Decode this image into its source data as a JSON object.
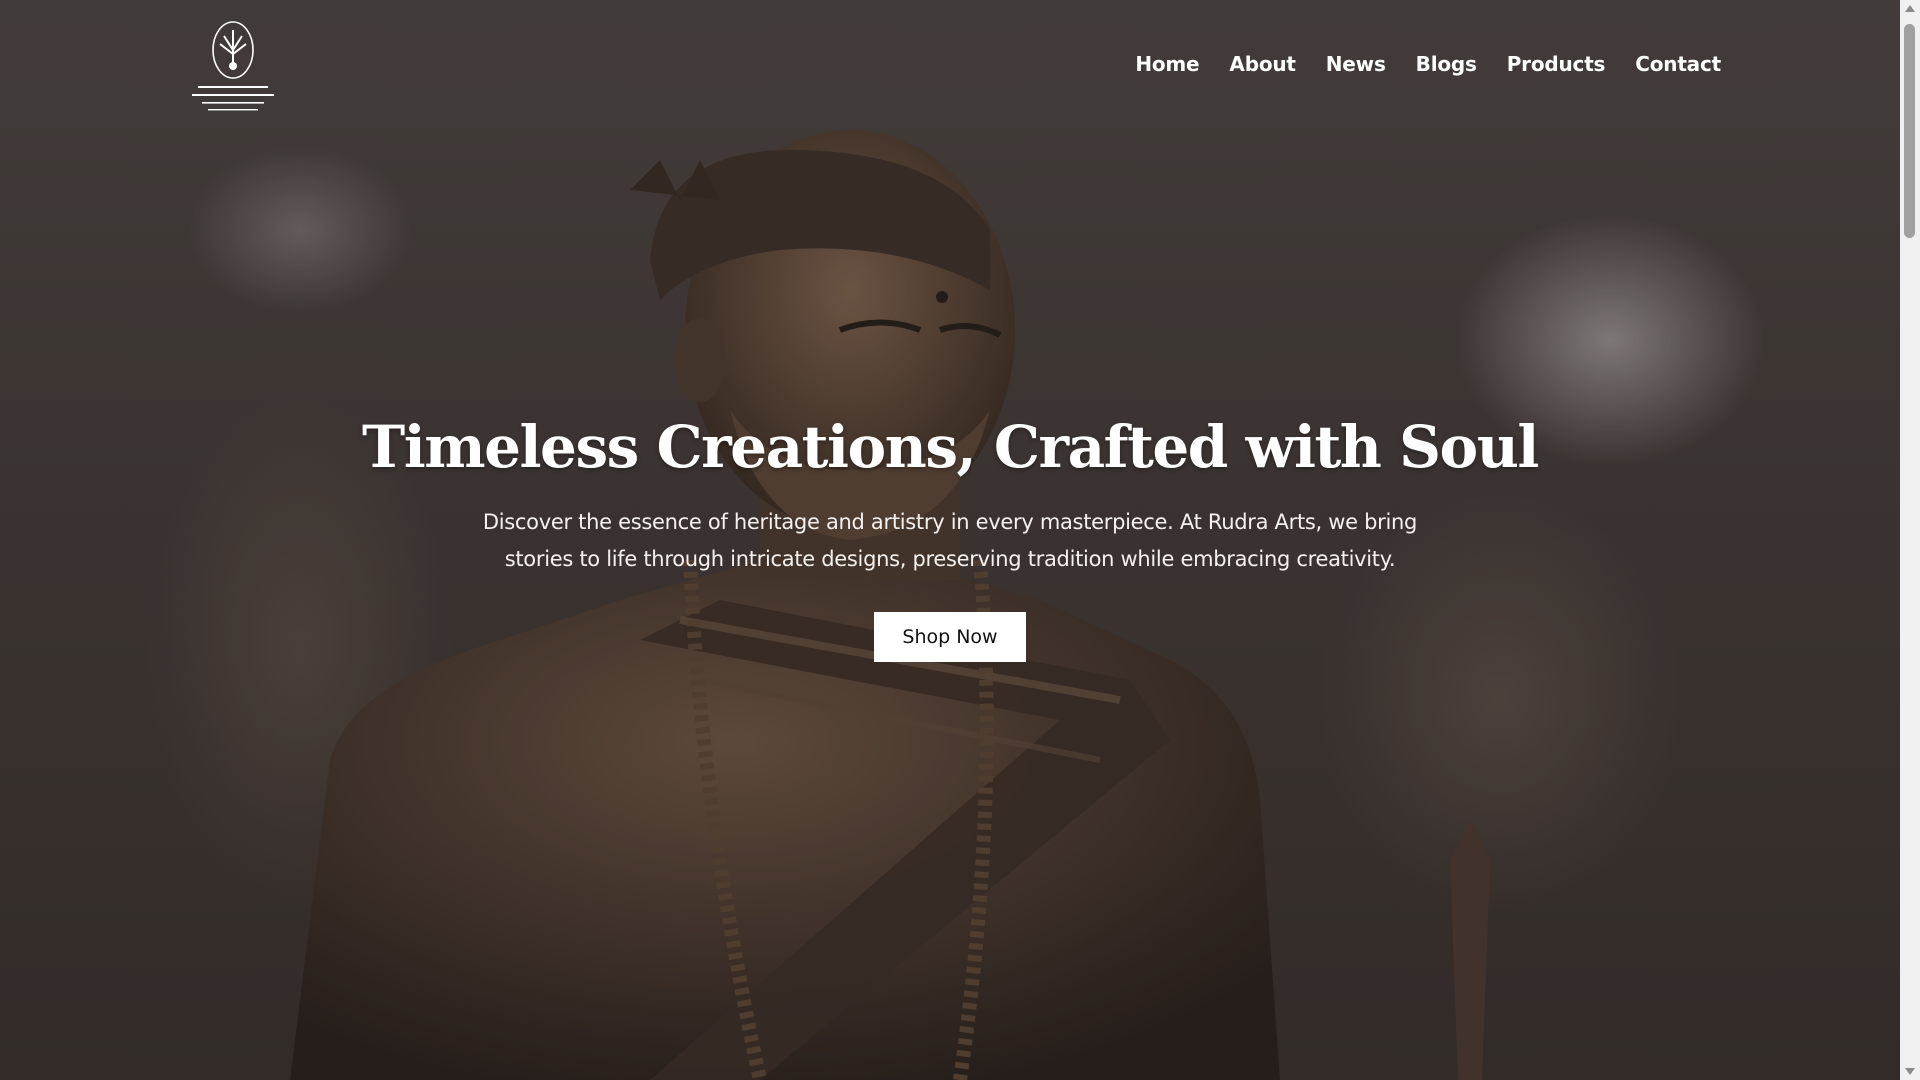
{
  "header": {
    "logo_alt": "Rudra Arts & Handicrafts logo",
    "nav": [
      {
        "label": "Home"
      },
      {
        "label": "About"
      },
      {
        "label": "News"
      },
      {
        "label": "Blogs"
      },
      {
        "label": "Products"
      },
      {
        "label": "Contact"
      }
    ]
  },
  "hero": {
    "title": "Timeless Creations, Crafted with Soul",
    "description": "Discover the essence of heritage and artistry in every masterpiece. At Rudra Arts, we bring stories to life through intricate designs, preserving tradition while embracing creativity.",
    "cta_label": "Shop Now"
  },
  "scrollbar": {
    "up_icon": "triangle-up-icon",
    "down_icon": "triangle-down-icon"
  }
}
